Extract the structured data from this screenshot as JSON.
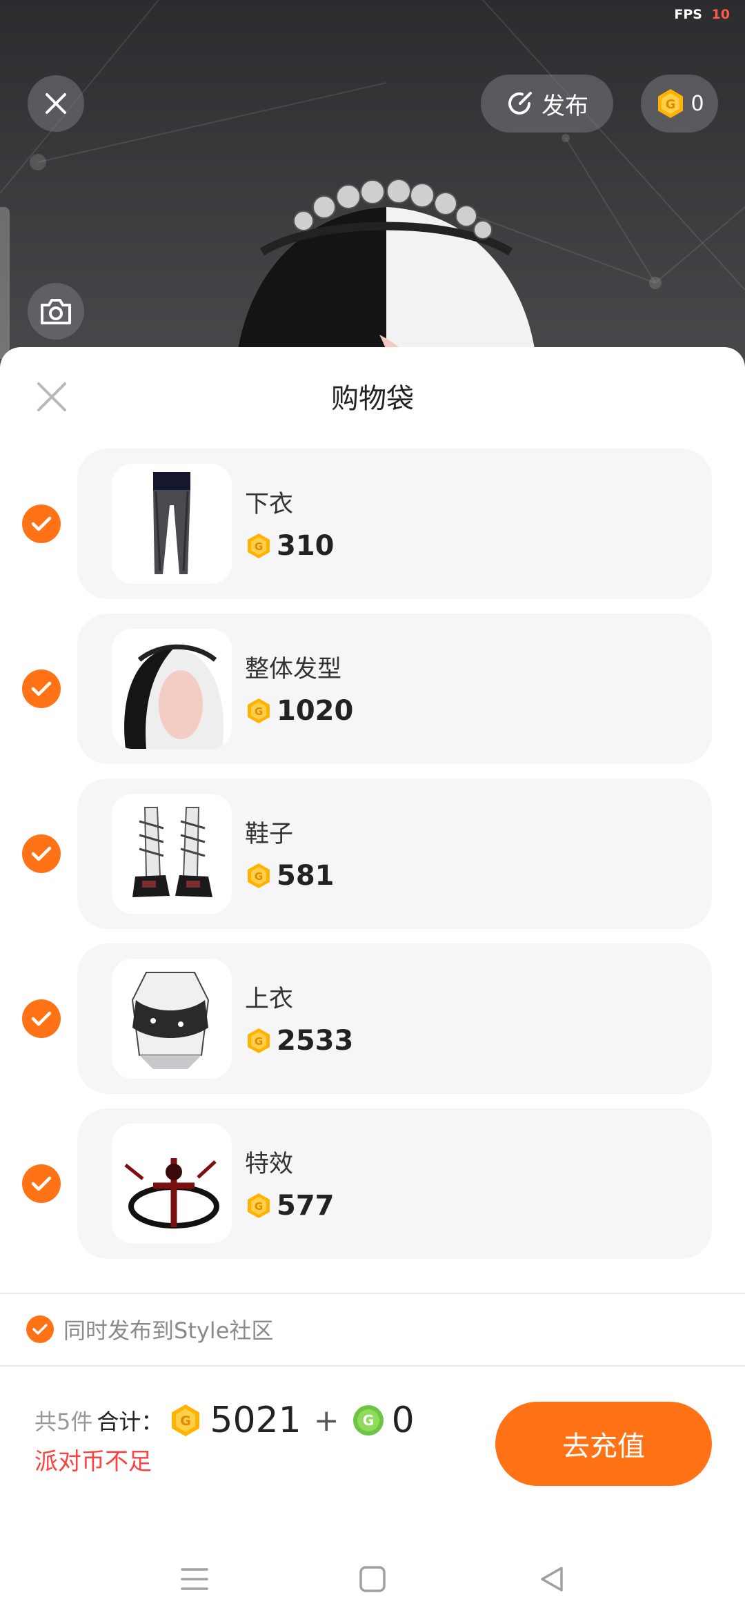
{
  "status": {
    "fps_label": "FPS",
    "fps_value": "10"
  },
  "top_bar": {
    "publish_label": "发布",
    "coin_balance": "0"
  },
  "sheet": {
    "title": "购物袋",
    "items": [
      {
        "name": "下衣",
        "price": "310",
        "checked": true,
        "thumb": "leggings"
      },
      {
        "name": "整体发型",
        "price": "1020",
        "checked": true,
        "thumb": "hairstyle"
      },
      {
        "name": "鞋子",
        "price": "581",
        "checked": true,
        "thumb": "boots"
      },
      {
        "name": "上衣",
        "price": "2533",
        "checked": true,
        "thumb": "top"
      },
      {
        "name": "特效",
        "price": "577",
        "checked": true,
        "thumb": "effect"
      }
    ],
    "publish_also": {
      "label": "同时发布到Style社区",
      "checked": true
    },
    "summary": {
      "count_text": "共5件",
      "total_label": "合计：",
      "party_coin_total": "5021",
      "plus": "+",
      "green_coin_total": "0",
      "warning": "派对币不足"
    },
    "recharge_label": "去充值"
  },
  "colors": {
    "accent": "#ff7316",
    "coin_gold": "#ffb300",
    "coin_green": "#6cc644",
    "warning": "#ff4040"
  }
}
